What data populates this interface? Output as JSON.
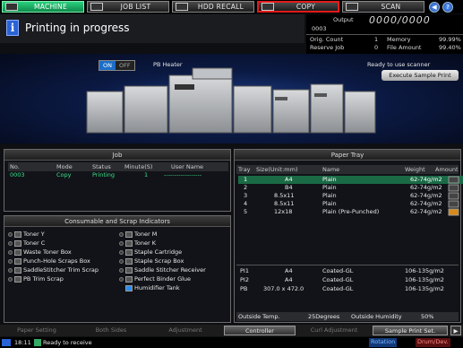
{
  "tabs": {
    "machine": "MACHINE",
    "job_list": "JOB LIST",
    "hdd_recall": "HDD RECALL",
    "copy": "COPY",
    "scan": "SCAN"
  },
  "header": {
    "status_title": "Printing in progress",
    "output_label": "Output",
    "output_value": "0000/0000",
    "job_number": "0003",
    "orig_count_label": "Orig. Count",
    "orig_count_value": "1",
    "memory_label": "Memory",
    "memory_value": "99.99%",
    "reserve_job_label": "Reserve Job",
    "reserve_job_value": "0",
    "file_amount_label": "File Amount",
    "file_amount_value": "99.40%"
  },
  "machine": {
    "toggle_on": "ON",
    "toggle_off": "OFF",
    "pb_heater": "PB Heater",
    "ready_scanner": "Ready to use scanner",
    "exec_sample": "Execute Sample Print"
  },
  "job_panel": {
    "title": "Job",
    "headers": [
      "No.",
      "Mode",
      "Status",
      "Minute(S)",
      "User Name"
    ],
    "row": {
      "no": "0003",
      "mode": "Copy",
      "status": "Printing",
      "minute": "1",
      "user": "------------------"
    }
  },
  "consumables": {
    "title": "Consumable and Scrap Indicators",
    "left": [
      "Toner Y",
      "Toner C",
      "Waste Toner Box",
      "Punch-Hole Scraps Box",
      "SaddleStitcher Trim Scrap",
      "PB Trim Scrap"
    ],
    "right": [
      "Toner M",
      "Toner K",
      "Staple Cartridge",
      "Staple Scrap Box",
      "Saddle Stitcher Receiver",
      "Perfect Binder Glue",
      "Humidifier Tank"
    ]
  },
  "paper_tray": {
    "title": "Paper Tray",
    "headers": [
      "Tray",
      "Size(Unit:mm)",
      "Name",
      "Weight",
      "Amount"
    ],
    "rows": [
      {
        "tray": "1",
        "size": "A4",
        "name": "Plain",
        "weight": "62-74g/m2"
      },
      {
        "tray": "2",
        "size": "B4",
        "name": "Plain",
        "weight": "62-74g/m2"
      },
      {
        "tray": "3",
        "size": "8.5x11",
        "name": "Plain",
        "weight": "62-74g/m2"
      },
      {
        "tray": "4",
        "size": "8.5x11",
        "name": "Plain",
        "weight": "62-74g/m2"
      },
      {
        "tray": "5",
        "size": "12x18",
        "name": "Plain (Pre-Punched)",
        "weight": "62-74g/m2"
      }
    ],
    "pi_rows": [
      {
        "tray": "PI1",
        "size": "A4",
        "name": "Coated-GL",
        "weight": "106-135g/m2"
      },
      {
        "tray": "PI2",
        "size": "A4",
        "name": "Coated-GL",
        "weight": "106-135g/m2"
      },
      {
        "tray": "PB",
        "size": "307.0 x 472.0",
        "name": "Coated-GL",
        "weight": "106-135g/m2"
      }
    ],
    "outside_temp_label": "Outside Temp.",
    "outside_temp_value": "25Degrees",
    "outside_humidity_label": "Outside Humidity",
    "outside_humidity_value": "50%"
  },
  "bottom": {
    "paper_setting": "Paper Setting",
    "both_sides": "Both Sides",
    "adjustment": "Adjustment",
    "controller": "Controller",
    "curl_adjustment": "Curl Adjustment",
    "sample_print_set": "Sample Print Set.",
    "time": "18:11",
    "receive": "Ready to receive",
    "rotation": "Rotation",
    "drum": "Drum/Dev."
  },
  "colors": {
    "accent_green": "#2bd07f",
    "selected_row": "#1a6b45",
    "copy_border": "#e21b1b"
  }
}
